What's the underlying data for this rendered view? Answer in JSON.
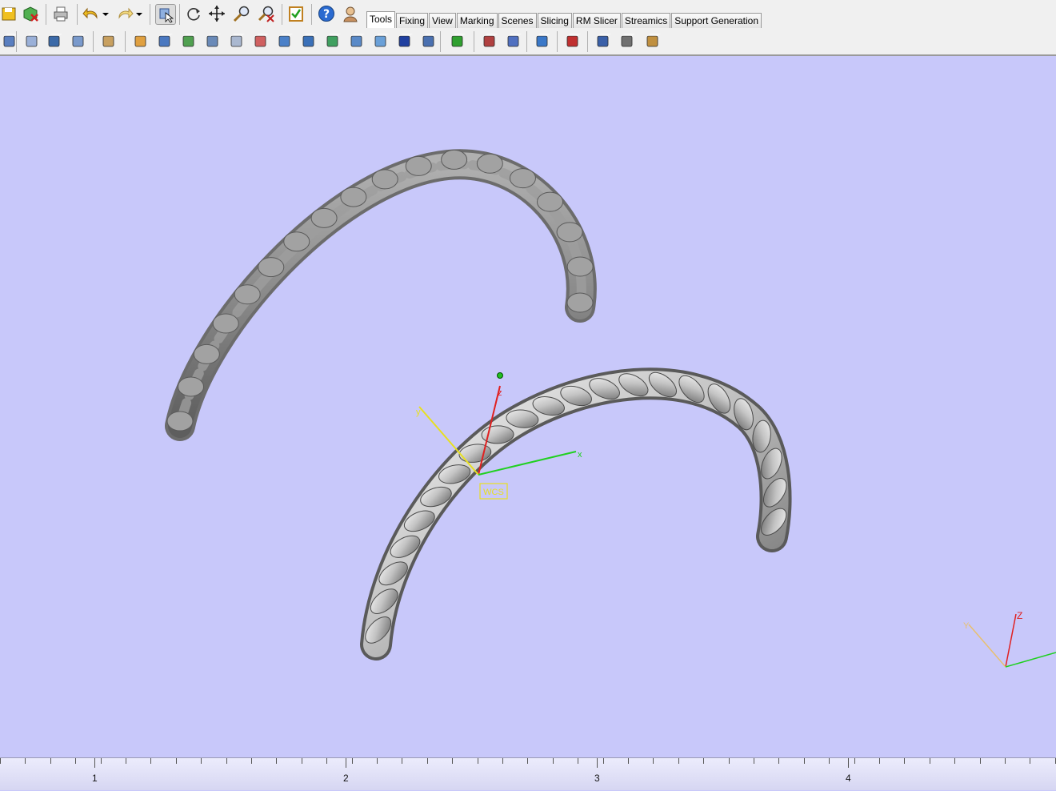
{
  "tabs": [
    "Tools",
    "Fixing",
    "View",
    "Marking",
    "Scenes",
    "Slicing",
    "RM Slicer",
    "Streamics",
    "Support Generation"
  ],
  "active_tab": "Tools",
  "toolbar_top": [
    {
      "name": "save-icon",
      "color": "#f0c020"
    },
    {
      "name": "export-part-icon",
      "color": "#40a040"
    },
    {
      "name": "print-icon",
      "color": "#707070"
    },
    {
      "name": "undo-icon",
      "color": "#f0c020"
    },
    {
      "name": "undo-dropdown-icon",
      "color": "#000000"
    },
    {
      "name": "redo-icon",
      "color": "#f0d070"
    },
    {
      "name": "redo-dropdown-icon",
      "color": "#000000"
    },
    {
      "name": "select-part-icon",
      "color": "#5080c0"
    },
    {
      "name": "rotate-icon",
      "color": "#404040"
    },
    {
      "name": "pan-icon",
      "color": "#404040"
    },
    {
      "name": "zoom-icon",
      "color": "#404040"
    },
    {
      "name": "zoom-window-icon",
      "color": "#404040"
    },
    {
      "name": "checklist-icon",
      "color": "#c08020"
    },
    {
      "name": "help-icon",
      "color": "#2060c0"
    },
    {
      "name": "wizard-icon",
      "color": "#c09060"
    }
  ],
  "toolbar_bottom": [
    {
      "name": "part-list-icon"
    },
    {
      "name": "cut-icon"
    },
    {
      "name": "copy-icon"
    },
    {
      "name": "paste-icon"
    },
    {
      "name": "hand-select-icon"
    },
    {
      "name": "import-part-icon"
    },
    {
      "name": "part-properties-icon"
    },
    {
      "name": "label-part-icon"
    },
    {
      "name": "measure-icon"
    },
    {
      "name": "duplicate-icon"
    },
    {
      "name": "mirror-icon"
    },
    {
      "name": "cube-view-icon"
    },
    {
      "name": "boolean-icon"
    },
    {
      "name": "extrude-icon"
    },
    {
      "name": "surface-icon"
    },
    {
      "name": "hollow-icon"
    },
    {
      "name": "solid-view-icon"
    },
    {
      "name": "shaded-view-icon"
    },
    {
      "name": "align-icon"
    },
    {
      "name": "translate-box-icon"
    },
    {
      "name": "coordinate-system-icon"
    },
    {
      "name": "platform-icon"
    },
    {
      "name": "recalculate-icon"
    },
    {
      "name": "settings-icon"
    },
    {
      "name": "layers-icon"
    },
    {
      "name": "package-icon"
    }
  ],
  "viewport": {
    "background": "#c8c8fa",
    "wcs_label": "WCS",
    "axis_labels": {
      "x": "x",
      "y": "y",
      "z": "z"
    },
    "corner_axis_labels": {
      "y": "Y",
      "z": "Z"
    },
    "axis_colors": {
      "x": "#20d020",
      "y": "#e8e020",
      "z": "#e02020"
    }
  },
  "ruler": {
    "labels": [
      "1",
      "2",
      "3",
      "4"
    ]
  }
}
